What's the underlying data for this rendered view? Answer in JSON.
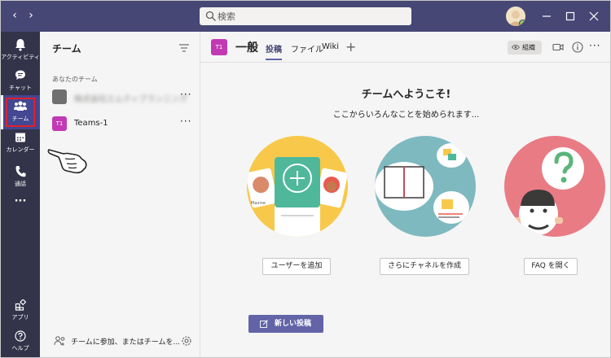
{
  "titlebar": {
    "back_arrow": "‹",
    "forward_arrow": "›",
    "search_placeholder": "検索"
  },
  "rail": {
    "items": [
      {
        "label": "アクティビティ",
        "icon": "bell-icon"
      },
      {
        "label": "チャット",
        "icon": "chat-icon"
      },
      {
        "label": "チーム",
        "icon": "teams-icon"
      },
      {
        "label": "カレンダー",
        "icon": "calendar-icon"
      },
      {
        "label": "通話",
        "icon": "phone-icon"
      },
      {
        "label": "アプリ",
        "icon": "apps-icon"
      },
      {
        "label": "ヘルプ",
        "icon": "help-icon"
      }
    ],
    "more_label": "···",
    "highlight_color": "#e0202a"
  },
  "panel": {
    "title": "チーム",
    "section_label": "あなたのチーム",
    "teams": [
      {
        "tile": "",
        "name": "株式会社エムティプランニング",
        "blurred": true,
        "tile_color": "#707070"
      },
      {
        "tile": "T1",
        "name": "Teams-1",
        "blurred": false,
        "tile_color": "#c239b3"
      }
    ],
    "more": "···",
    "footer_text": "チームに参加、またはチームを..."
  },
  "main": {
    "channel_tile": "T1",
    "channel_name": "一般",
    "tabs": [
      "投稿",
      "ファイル",
      "Wiki"
    ],
    "active_tab": "投稿",
    "add_tab": "+",
    "org_label": "組織",
    "welcome_title": "チームへようこそ!",
    "welcome_sub": "ここからいろんなことを始められます...",
    "actions": [
      "ユーザーを追加",
      "さらにチャネルを作成",
      "FAQ を開く"
    ],
    "new_post": "新しい投稿",
    "person_label": "Maxine"
  },
  "colors": {
    "titlebar": "#464775",
    "rail": "#33344a",
    "accent": "#6264a7",
    "channel_tile": "#c239b3",
    "circle1": "#f8c84a",
    "circle2": "#7fb9c0",
    "circle3": "#e97b85"
  }
}
